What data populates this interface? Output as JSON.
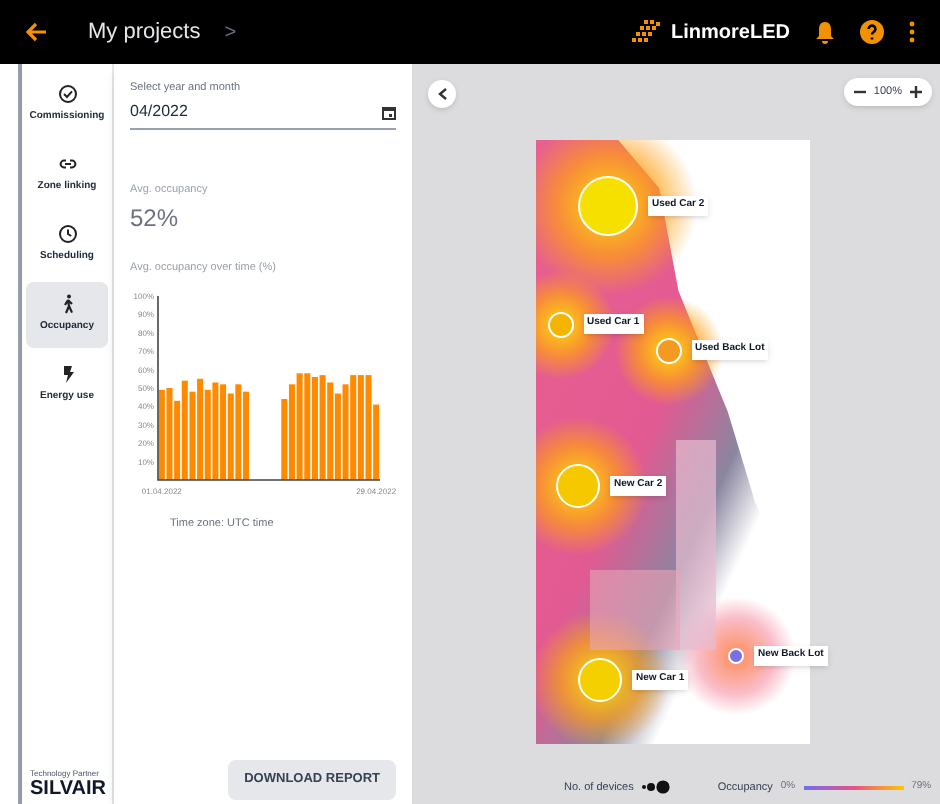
{
  "header": {
    "breadcrumb": "My projects",
    "separator": ">",
    "logo_text": "LinmoreLED"
  },
  "sidebar": {
    "items": [
      {
        "label": "Commissioning",
        "kind": "check",
        "selected": false
      },
      {
        "label": "Zone linking",
        "kind": "link",
        "selected": false
      },
      {
        "label": "Scheduling",
        "kind": "clock",
        "selected": false
      },
      {
        "label": "Occupancy",
        "kind": "walk",
        "selected": true
      },
      {
        "label": "Energy use",
        "kind": "bolt",
        "selected": false
      }
    ],
    "partner_caption": "Technology Partner",
    "partner_name": "SILVAIR"
  },
  "panel": {
    "date_field": {
      "label": "Select year and month",
      "value": "04/2022"
    },
    "avg_label": "Avg. occupancy",
    "avg_value": "52%",
    "chart_title": "Avg. occupancy over time (%)",
    "chart_data": {
      "type": "bar",
      "categories": [
        "01.04.2022",
        null,
        null,
        null,
        null,
        null,
        null,
        null,
        null,
        null,
        null,
        null,
        null,
        null,
        null,
        null,
        null,
        null,
        null,
        null,
        null,
        null,
        null,
        null,
        null,
        null,
        null,
        null,
        "29.04.2022"
      ],
      "values": [
        49,
        50,
        43,
        54,
        48,
        55,
        49,
        53,
        52,
        47,
        52,
        48,
        0,
        0,
        0,
        0,
        44,
        52,
        58,
        58,
        56,
        57,
        53,
        47,
        52,
        57,
        57,
        57,
        41
      ],
      "ylim": [
        0,
        100
      ],
      "yticks": [
        {
          "value": 10,
          "label": "10%"
        },
        {
          "value": 20,
          "label": "20%"
        },
        {
          "value": 30,
          "label": "30%"
        },
        {
          "value": 40,
          "label": "40%"
        },
        {
          "value": 50,
          "label": "50%"
        },
        {
          "value": 60,
          "label": "60%"
        },
        {
          "value": 70,
          "label": "70%"
        },
        {
          "value": 80,
          "label": "80%"
        },
        {
          "value": 90,
          "label": "90%"
        },
        {
          "value": 100,
          "label": "100%"
        }
      ]
    },
    "timezone": "Time zone: UTC time",
    "download_button": "DOWNLOAD REPORT"
  },
  "map": {
    "zoom": "100%",
    "zones": [
      {
        "name": "Used Car 2",
        "kind": "large",
        "color": "#f5e000"
      },
      {
        "name": "Used Car 1",
        "kind": "small",
        "color": "#f5b400"
      },
      {
        "name": "Used Back Lot",
        "kind": "small",
        "color": "#f59a20"
      },
      {
        "name": "New Car 2",
        "kind": "medium",
        "color": "#f5c800"
      },
      {
        "name": "New Car 1",
        "kind": "medium",
        "color": "#f5d000"
      },
      {
        "name": "New Back Lot",
        "kind": "tiny",
        "color": "#7a6ee0"
      }
    ],
    "legend": {
      "devices_label": "No. of devices",
      "occupancy_label": "Occupancy",
      "min": "0%",
      "max": "79%"
    }
  }
}
